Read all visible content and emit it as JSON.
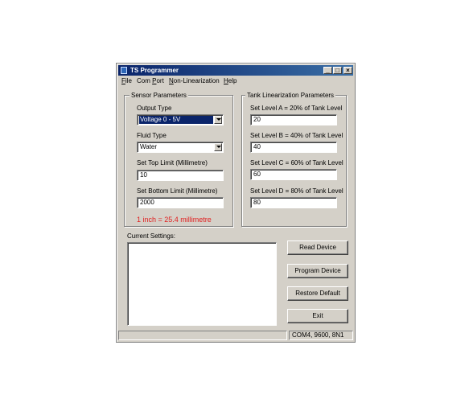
{
  "window": {
    "title": "TS Programmer"
  },
  "menu": [
    {
      "pre": "",
      "u": "F",
      "post": "ile"
    },
    {
      "pre": "Com ",
      "u": "P",
      "post": "ort"
    },
    {
      "pre": "",
      "u": "N",
      "post": "on-Linearization"
    },
    {
      "pre": "",
      "u": "H",
      "post": "elp"
    }
  ],
  "sensor": {
    "legend": "Sensor Parameters",
    "output_type_label": "Output Type",
    "output_type_value": "Voltage 0 - 5V",
    "fluid_type_label": "Fluid Type",
    "fluid_type_value": "Water",
    "top_limit_label": "Set Top Limit (Millimetre)",
    "top_limit_value": "10",
    "bottom_limit_label": "Set Bottom Limit (Millimetre)",
    "bottom_limit_value": "2000",
    "conversion_note": "1 inch = 25.4 millimetre",
    "note_color": "#e02020"
  },
  "tank": {
    "legend": "Tank Linearization Parameters",
    "levels": [
      {
        "label": "Set Level A = 20% of Tank Level",
        "value": "20"
      },
      {
        "label": "Set Level B = 40% of Tank Level",
        "value": "40"
      },
      {
        "label": "Set Level C = 60% of Tank Level",
        "value": "60"
      },
      {
        "label": "Set Level D = 80% of Tank Level",
        "value": "80"
      }
    ]
  },
  "current_settings": {
    "label": "Current Settings:",
    "text": ""
  },
  "buttons": {
    "read": "Read Device",
    "program": "Program Device",
    "restore": "Restore Default",
    "exit": "Exit"
  },
  "status": {
    "left": "",
    "right": "COM4, 9600, 8N1"
  },
  "colors": {
    "titlebar": "#0a246a",
    "face": "#d4d0c8",
    "selection": "#0a246a"
  }
}
